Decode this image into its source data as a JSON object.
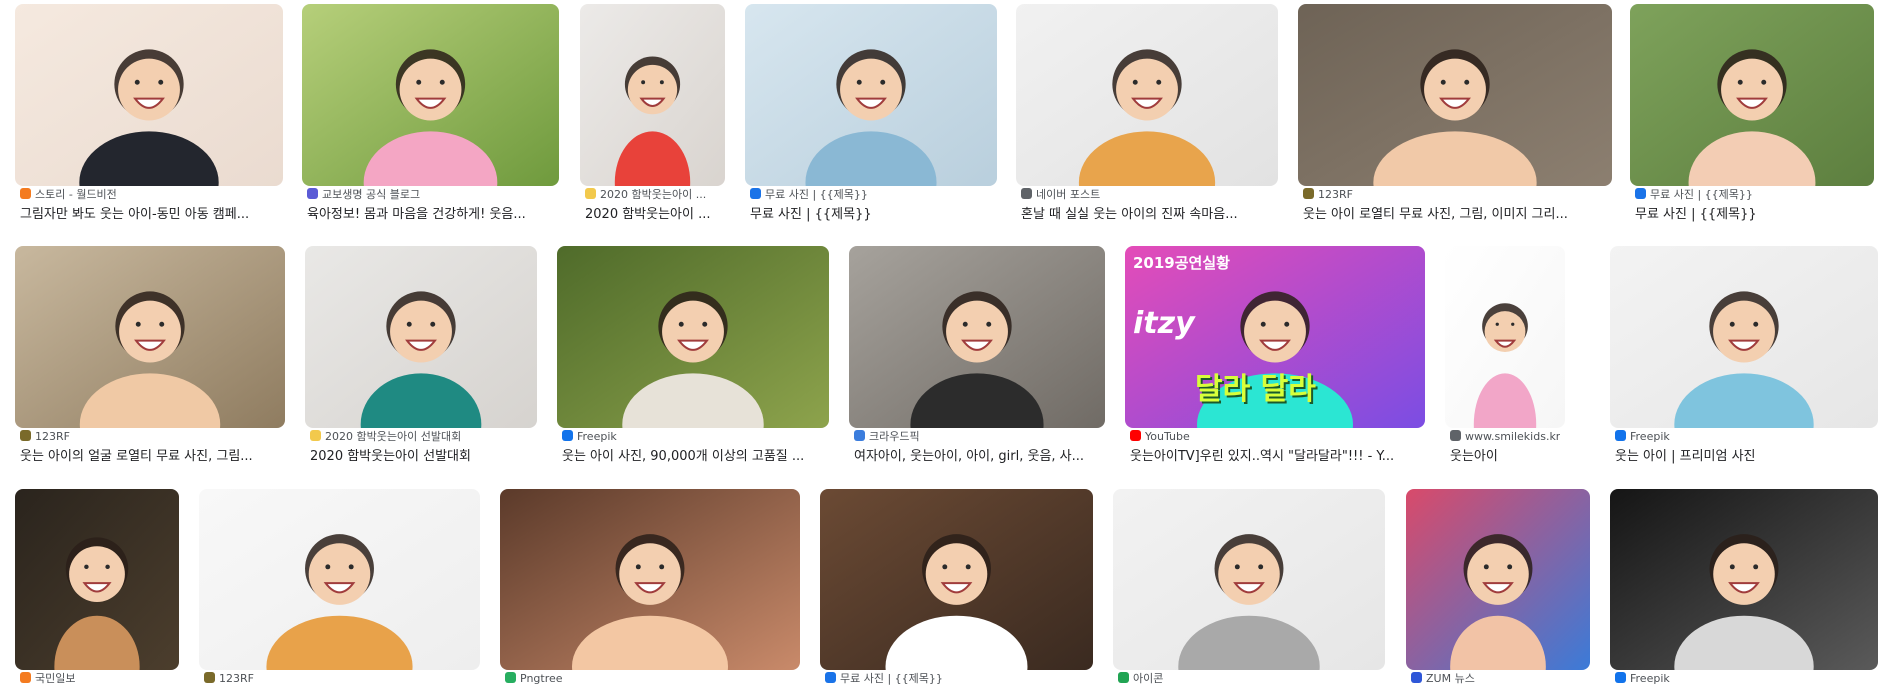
{
  "results": {
    "row1": [
      {
        "source": "스토리 - 월드비전",
        "title": "그림자만 봐도 웃는 아이-동민 아동 캠페...",
        "icon": "orange-square-icon",
        "icon_color": "#f47b20",
        "bg": [
          "#f5e9df",
          "#eadbd0"
        ],
        "subject": "#23262e"
      },
      {
        "source": "교보생명 공식 블로그",
        "title": "육아정보! 몸과 마음을 건강하게! 웃음...",
        "icon": "house-icon",
        "icon_color": "#5b5bd6",
        "bg": [
          "#b6cf7a",
          "#6f9a3d"
        ],
        "subject": "#f4a6c4"
      },
      {
        "source": "2020 함박웃는아이 ...",
        "title": "2020 함박웃는아이 ...",
        "icon": "smile-line-icon",
        "icon_color": "#f2c94c",
        "bg": [
          "#eceae8",
          "#d9d4cf"
        ],
        "subject": "#e8423a"
      },
      {
        "source": "무료 사진 | {{제목}}",
        "title": "무료 사진 | {{제목}}",
        "icon": "caret-up-icon",
        "icon_color": "#1a73e8",
        "bg": [
          "#d7e6ef",
          "#b9cfdd"
        ],
        "subject": "#8ab8d4"
      },
      {
        "source": "네이버 포스트",
        "title": "혼날 때 실실 웃는 아이의 진짜 속마음...",
        "icon": "globe-icon",
        "icon_color": "#5f6368",
        "bg": [
          "#f1f1f1",
          "#e2e2e2"
        ],
        "subject": "#e8a44c"
      },
      {
        "source": "123RF",
        "title": "웃는 아이 로열티 무료 사진, 그림, 이미지 그리...",
        "icon": "circle-logo-icon",
        "icon_color": "#7a6a2a",
        "bg": [
          "#6e6356",
          "#8c7f70"
        ],
        "subject": "#f1c9a8"
      },
      {
        "source": "무료 사진 | {{제목}}",
        "title": "무료 사진 | {{제목}}",
        "icon": "caret-up-icon",
        "icon_color": "#1a73e8",
        "bg": [
          "#7ea25b",
          "#5d7f3f"
        ],
        "subject": "#f3cdb4"
      }
    ],
    "row2": [
      {
        "source": "123RF",
        "title": "웃는 아이의 얼굴 로열티 무료 사진, 그림...",
        "icon": "circle-logo-icon",
        "icon_color": "#7a6a2a",
        "bg": [
          "#c8b89e",
          "#8f7c60"
        ],
        "subject": "#f0c9a5"
      },
      {
        "source": "2020 함박웃는아이 선발대회",
        "title": "2020 함박웃는아이 선발대회",
        "icon": "smile-line-icon",
        "icon_color": "#f2c94c",
        "bg": [
          "#e9e8e6",
          "#d6d3cf"
        ],
        "subject": "#1f8a82"
      },
      {
        "source": "Freepik",
        "title": "웃는 아이 사진, 90,000개 이상의 고품질 ...",
        "icon": "freepik-icon",
        "icon_color": "#1273eb",
        "bg": [
          "#4f6b2a",
          "#8da34c"
        ],
        "subject": "#e7e2d8"
      },
      {
        "source": "크라우드픽",
        "title": "여자아이, 웃는아이, 아이, girl, 웃음, 사...",
        "icon": "crowdpic-icon",
        "icon_color": "#3b7ddd",
        "bg": [
          "#a6a29c",
          "#706b65"
        ],
        "subject": "#2c2c2c"
      },
      {
        "source": "YouTube",
        "title": "웃는아이TV]우린 있지..역시 \"달라달라\"!!! - Y...",
        "icon": "youtube-icon",
        "icon_color": "#ff0000",
        "bg": [
          "#e44cb8",
          "#7b4de3"
        ],
        "subject": "#2be6d3",
        "overlay1": "2019공연실황",
        "overlay2": "itzy",
        "overlay3": "달라 달라"
      },
      {
        "source": "www.smilekids.kr",
        "title": "웃는아이",
        "icon": "globe-icon",
        "icon_color": "#5f6368",
        "bg": [
          "#ffffff",
          "#f6f6f6"
        ],
        "subject": "#f2a6c8"
      },
      {
        "source": "Freepik",
        "title": "웃는 아이 | 프리미엄 사진",
        "icon": "freepik-icon",
        "icon_color": "#1273eb",
        "bg": [
          "#f3f3f3",
          "#e6e6e6"
        ],
        "subject": "#7fc4de"
      }
    ],
    "row3": [
      {
        "source": "국민일보",
        "title": "",
        "icon": "orange-square-icon",
        "icon_color": "#f47b20",
        "bg": [
          "#2a241d",
          "#4c3e2d"
        ],
        "subject": "#c98f5a"
      },
      {
        "source": "123RF",
        "title": "",
        "icon": "circle-logo-icon",
        "icon_color": "#7a6a2a",
        "bg": [
          "#f8f8f8",
          "#eeeeee"
        ],
        "subject": "#e8a24a"
      },
      {
        "source": "Pngtree",
        "title": "",
        "icon": "pngtree-icon",
        "icon_color": "#27ae60",
        "bg": [
          "#5b3a2a",
          "#c98a6a"
        ],
        "subject": "#f3c7a3"
      },
      {
        "source": "무료 사진 | {{제목}}",
        "title": "",
        "icon": "caret-up-icon",
        "icon_color": "#1a73e8",
        "bg": [
          "#6b4a34",
          "#3a2a20"
        ],
        "subject": "#ffffff"
      },
      {
        "source": "아이콘",
        "title": "",
        "icon": "green-square-icon",
        "icon_color": "#21a453",
        "bg": [
          "#f2f2f2",
          "#e6e6e6"
        ],
        "subject": "#a9a9a9"
      },
      {
        "source": "ZUM 뉴스",
        "title": "",
        "icon": "zum-icon",
        "icon_color": "#2f57d8",
        "bg": [
          "#d94a6a",
          "#3b7bd8"
        ],
        "subject": "#f2c3a6"
      },
      {
        "source": "Freepik",
        "title": "",
        "icon": "freepik-icon",
        "icon_color": "#1273eb",
        "bg": [
          "#151515",
          "#5a5a5a"
        ],
        "subject": "#d8d8d8"
      }
    ]
  }
}
